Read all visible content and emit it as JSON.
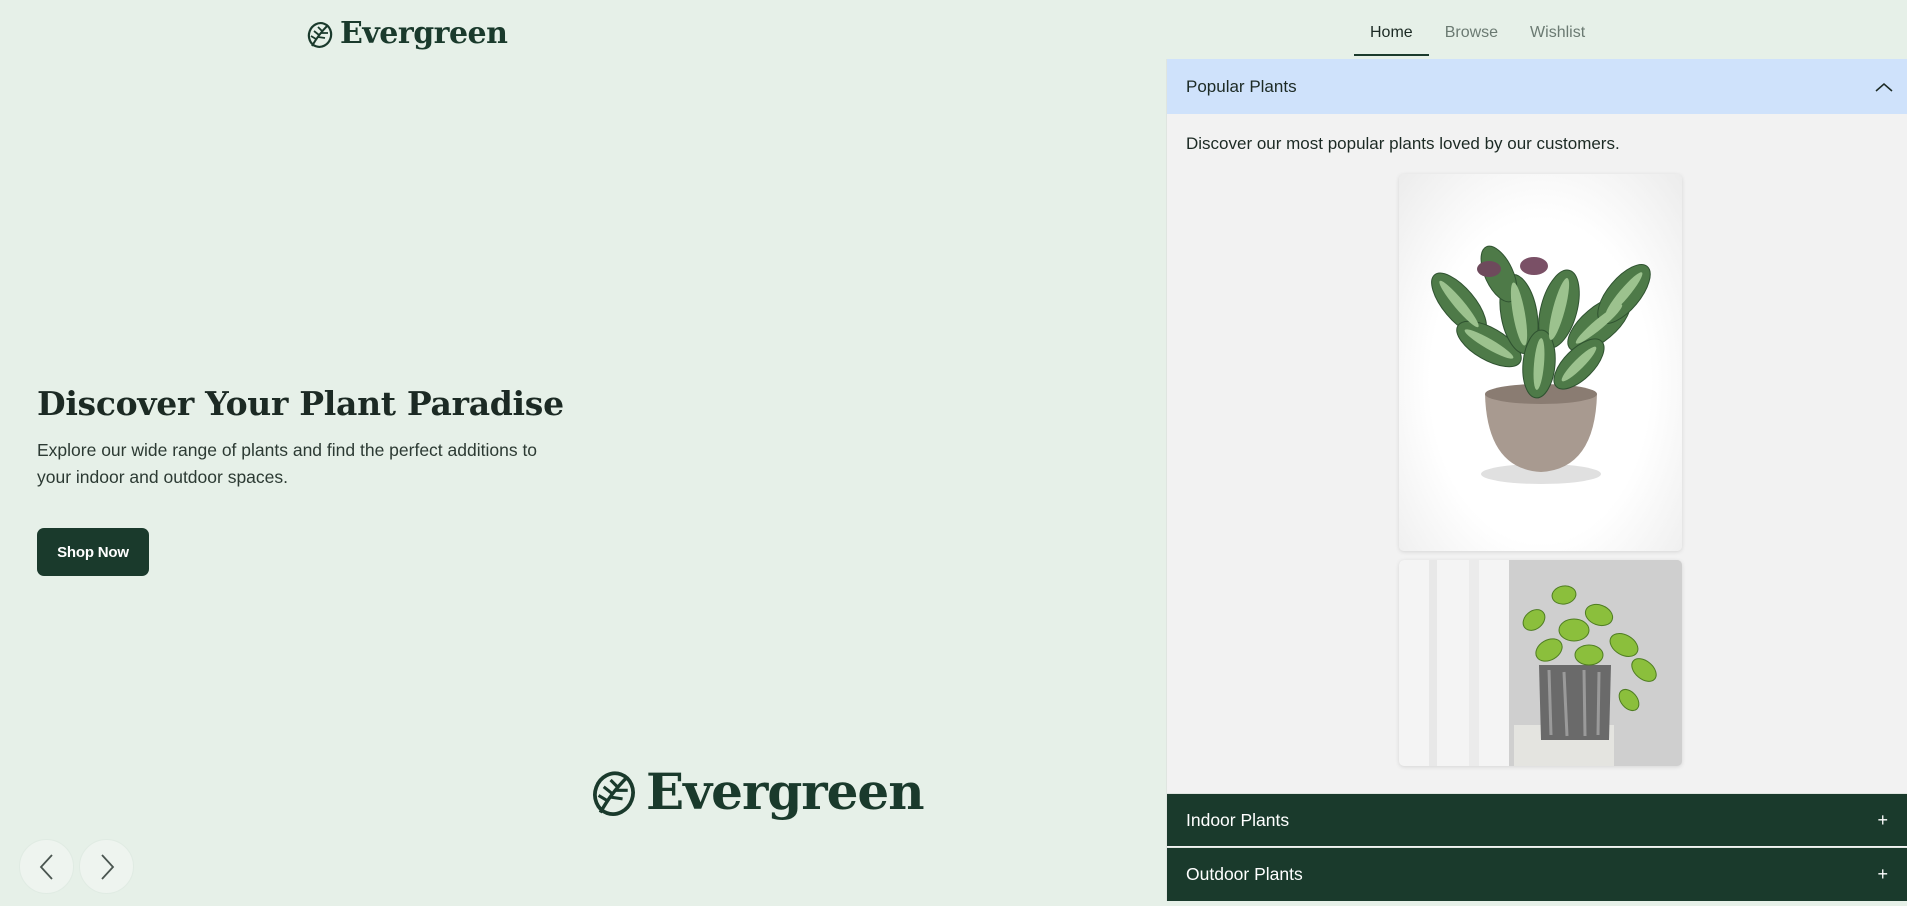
{
  "brand": {
    "name": "Evergreen"
  },
  "nav": {
    "tabs": [
      {
        "label": "Home",
        "active": true
      },
      {
        "label": "Browse",
        "active": false
      },
      {
        "label": "Wishlist",
        "active": false
      }
    ]
  },
  "hero": {
    "title": "Discover Your Plant Paradise",
    "subtitle": "Explore our wide range of plants and find the perfect additions to your indoor and outdoor spaces.",
    "cta_label": "Shop Now"
  },
  "carousel": {
    "prev_icon": "chevron-left-icon",
    "next_icon": "chevron-right-icon"
  },
  "accordion": {
    "sections": [
      {
        "title": "Popular Plants",
        "expanded": true,
        "toggle_icon": "chevron-up-icon",
        "description": "Discover our most popular plants loved by our customers."
      },
      {
        "title": "Indoor Plants",
        "expanded": false,
        "toggle_label": "+"
      },
      {
        "title": "Outdoor Plants",
        "expanded": false,
        "toggle_label": "+"
      }
    ]
  },
  "colors": {
    "background": "#e6f0e8",
    "brand_dark": "#1a3a2c",
    "accordion_active": "#cfe2fb",
    "panel_bg": "#f2f2f2"
  }
}
